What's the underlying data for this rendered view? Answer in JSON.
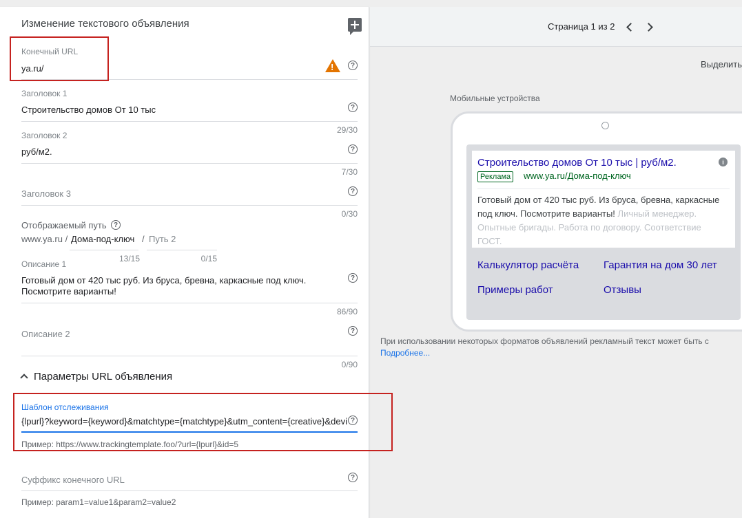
{
  "panel": {
    "title": "Изменение текстового объявления"
  },
  "final_url": {
    "label": "Конечный URL",
    "value": "ya.ru/"
  },
  "headline1": {
    "label": "Заголовок 1",
    "value": "Строительство домов От 10 тыс",
    "counter": "29/30"
  },
  "headline2": {
    "label": "Заголовок 2",
    "value": "руб/м2.",
    "counter": "7/30"
  },
  "headline3": {
    "label": "Заголовок 3",
    "value": "",
    "counter": "0/30"
  },
  "display_path": {
    "label": "Отображаемый путь",
    "domain": "www.ya.ru /",
    "path1": "Дома-под-ключ",
    "separator": "/",
    "path2_placeholder": "Путь 2",
    "path1_counter": "13/15",
    "path2_counter": "0/15"
  },
  "description1": {
    "label": "Описание 1",
    "line1": "Готовый дом от 420 тыс руб. Из бруса, бревна, каркасные под ключ.",
    "line2": "Посмотрите варианты!",
    "counter": "86/90"
  },
  "description2": {
    "label": "Описание 2",
    "value": "",
    "counter": "0/90"
  },
  "url_params": {
    "section_title": "Параметры URL объявления",
    "tracking_label": "Шаблон отслеживания",
    "tracking_value": "{lpurl}?keyword={keyword}&matchtype={matchtype}&utm_content={creative}&devi",
    "tracking_example": "Пример: https://www.trackingtemplate.foo/?url={lpurl}&id=5",
    "suffix_label": "Суффикс конечного URL",
    "suffix_example": "Пример: param1=value1&param2=value2"
  },
  "preview": {
    "page_indicator": "Страница 1 из 2",
    "highlight_label": "Выделить",
    "device_label": "Мобильные устройства",
    "ad": {
      "title": "Строительство домов От 10 тыс | руб/м2.",
      "badge": "Реклама",
      "display_url": "www.ya.ru/Дома-под-ключ",
      "description": "Готовый дом от 420 тыс руб. Из бруса, бревна, каркасные под ключ. Посмотрите варианты!",
      "description_faded": "Личный менеджер. Опытные бригады. Работа по договору. Соответствие ГОСТ.",
      "sitelinks": [
        "Калькулятор расчёта",
        "Гарантия на дом 30 лет",
        "Примеры работ",
        "Отзывы"
      ]
    },
    "note": "При использовании некоторых форматов объявлений рекламный текст может быть с",
    "more_link": "Подробнее..."
  },
  "colors": {
    "accent": "#1a73e8",
    "warning": "#e37400",
    "highlight_box": "#c5221f",
    "ad_link": "#1a0dab",
    "ad_url": "#006621"
  }
}
